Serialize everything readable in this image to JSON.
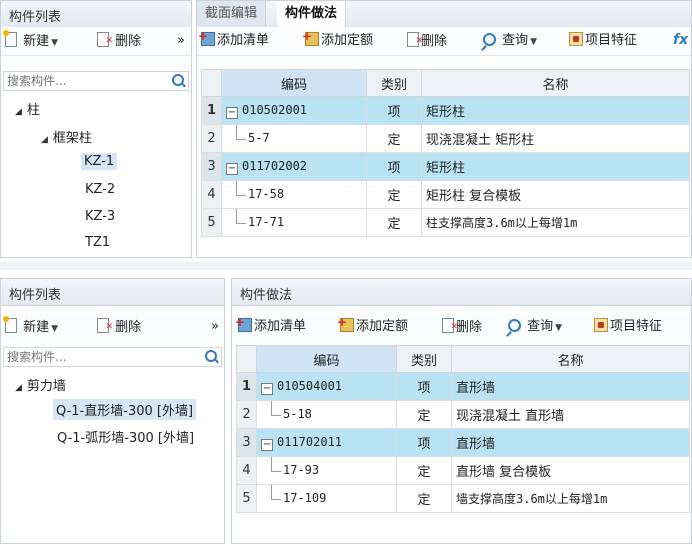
{
  "top": {
    "left": {
      "title": "构件列表",
      "new_label": "新建",
      "delete_label": "删除",
      "more": "»",
      "search_placeholder": "搜索构件...",
      "tree": {
        "root": "柱",
        "group": "框架柱",
        "items": [
          "KZ-1",
          "KZ-2",
          "KZ-3",
          "TZ1"
        ]
      }
    },
    "right": {
      "tabs": [
        "截面编辑",
        "构件做法"
      ],
      "toolbar": {
        "add_list": "添加清单",
        "add_quota": "添加定额",
        "delete": "删除",
        "query": "查询",
        "features": "项目特征",
        "fx": "fx"
      },
      "columns": [
        "编码",
        "类别",
        "名称"
      ],
      "rows": [
        {
          "no": "1",
          "code": "010502001",
          "cat": "项",
          "name": "矩形柱"
        },
        {
          "no": "2",
          "code": "5-7",
          "cat": "定",
          "name": "现浇混凝土 矩形柱"
        },
        {
          "no": "3",
          "code": "011702002",
          "cat": "项",
          "name": "矩形柱"
        },
        {
          "no": "4",
          "code": "17-58",
          "cat": "定",
          "name": "矩形柱 复合模板"
        },
        {
          "no": "5",
          "code": "17-71",
          "cat": "定",
          "name": "柱支撑高度3.6m以上每增1m"
        }
      ]
    }
  },
  "bottom": {
    "left": {
      "title": "构件列表",
      "new_label": "新建",
      "delete_label": "删除",
      "more": "»",
      "search_placeholder": "搜索构件...",
      "tree": {
        "root": "剪力墙",
        "items": [
          "Q-1-直形墙-300 [外墙]",
          "Q-1-弧形墙-300 [外墙]"
        ]
      }
    },
    "right": {
      "title": "构件做法",
      "toolbar": {
        "add_list": "添加清单",
        "add_quota": "添加定额",
        "delete": "删除",
        "query": "查询",
        "features": "项目特征"
      },
      "columns": [
        "编码",
        "类别",
        "名称"
      ],
      "rows": [
        {
          "no": "1",
          "code": "010504001",
          "cat": "项",
          "name": "直形墙"
        },
        {
          "no": "2",
          "code": "5-18",
          "cat": "定",
          "name": "现浇混凝土 直形墙"
        },
        {
          "no": "3",
          "code": "011702011",
          "cat": "项",
          "name": "直形墙"
        },
        {
          "no": "4",
          "code": "17-93",
          "cat": "定",
          "name": "直形墙 复合模板"
        },
        {
          "no": "5",
          "code": "17-109",
          "cat": "定",
          "name": "墙支撑高度3.6m以上每增1m"
        }
      ]
    }
  }
}
